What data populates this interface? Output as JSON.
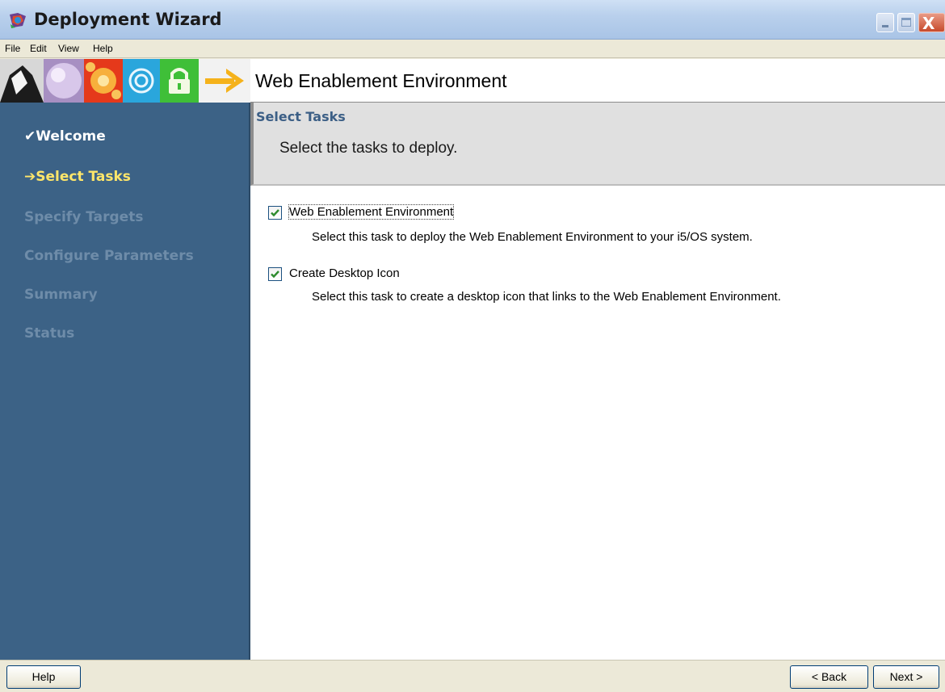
{
  "window": {
    "title": "Deployment Wizard",
    "controls": [
      "minimize",
      "maximize",
      "close"
    ],
    "close_glyph": "X"
  },
  "menu": [
    "File",
    "Edit",
    "View",
    "Help"
  ],
  "banner": {
    "title": "Web Enablement Environment",
    "icons": [
      "person-icon",
      "sphere-icon",
      "flower-icon",
      "spiral-icon",
      "lock-icon",
      "arrow-right-icon"
    ]
  },
  "steps": [
    {
      "mark": "✔",
      "label": "Welcome",
      "state": "done"
    },
    {
      "mark": "➔",
      "label": "Select Tasks",
      "state": "current"
    },
    {
      "mark": "",
      "label": "Specify Targets",
      "state": "pending"
    },
    {
      "mark": "",
      "label": "Configure Parameters",
      "state": "pending"
    },
    {
      "mark": "",
      "label": "Summary",
      "state": "pending"
    },
    {
      "mark": "",
      "label": "Status",
      "state": "pending"
    }
  ],
  "section": {
    "title": "Select Tasks",
    "subtitle": "Select the tasks to deploy."
  },
  "tasks": [
    {
      "label": "Web Enablement Environment",
      "checked": true,
      "description": "Select this task to deploy the Web Enablement Environment to your i5/OS system."
    },
    {
      "label": "Create Desktop Icon",
      "checked": true,
      "description": "Select this task to create a desktop icon that links to the Web Enablement Environment."
    }
  ],
  "buttons": {
    "help": "Help",
    "back": "< Back",
    "next": "Next >"
  },
  "colors": {
    "sidebar": "#3c6286",
    "current_step": "#ffe66a",
    "pending_step": "#6e8ca9",
    "section_title": "#3c5f86",
    "check": "#2e8b2e"
  }
}
